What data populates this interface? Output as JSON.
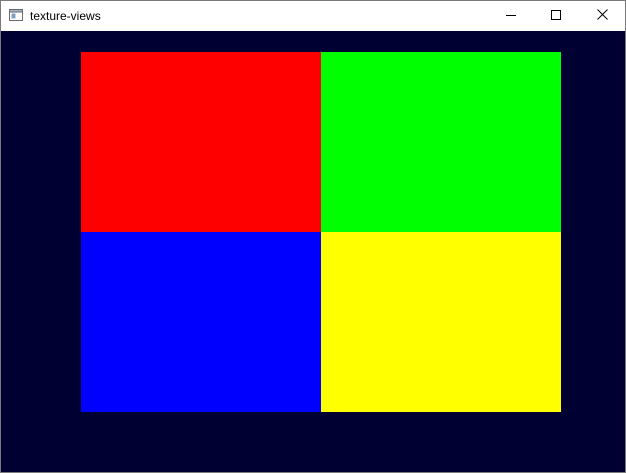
{
  "window": {
    "title": "texture-views",
    "icon": "app-window-icon"
  },
  "caption_buttons": {
    "minimize_icon": "minimize-icon",
    "maximize_icon": "maximize-icon",
    "close_icon": "close-icon"
  },
  "canvas": {
    "clear_color": "#000033",
    "quadrants": [
      {
        "position": "top-left",
        "color": "#ff0000"
      },
      {
        "position": "top-right",
        "color": "#00ff00"
      },
      {
        "position": "bottom-left",
        "color": "#0000ff"
      },
      {
        "position": "bottom-right",
        "color": "#ffff00"
      }
    ]
  }
}
